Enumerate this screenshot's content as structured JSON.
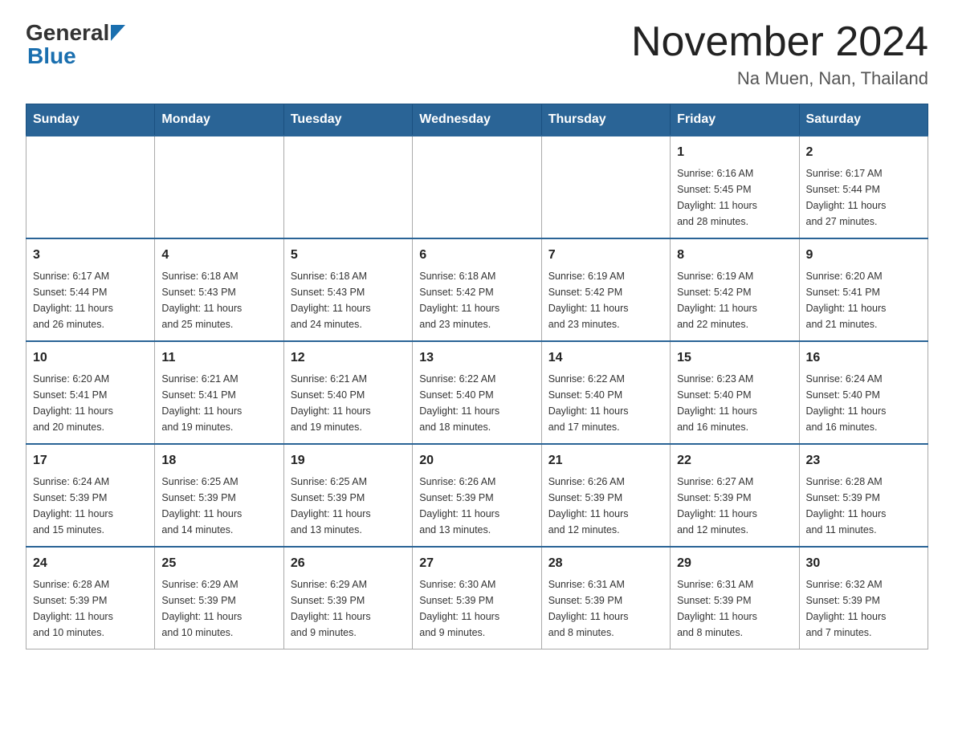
{
  "header": {
    "logo_general": "General",
    "logo_blue": "Blue",
    "month_title": "November 2024",
    "location": "Na Muen, Nan, Thailand"
  },
  "weekdays": [
    "Sunday",
    "Monday",
    "Tuesday",
    "Wednesday",
    "Thursday",
    "Friday",
    "Saturday"
  ],
  "weeks": [
    [
      {
        "day": "",
        "info": ""
      },
      {
        "day": "",
        "info": ""
      },
      {
        "day": "",
        "info": ""
      },
      {
        "day": "",
        "info": ""
      },
      {
        "day": "",
        "info": ""
      },
      {
        "day": "1",
        "info": "Sunrise: 6:16 AM\nSunset: 5:45 PM\nDaylight: 11 hours\nand 28 minutes."
      },
      {
        "day": "2",
        "info": "Sunrise: 6:17 AM\nSunset: 5:44 PM\nDaylight: 11 hours\nand 27 minutes."
      }
    ],
    [
      {
        "day": "3",
        "info": "Sunrise: 6:17 AM\nSunset: 5:44 PM\nDaylight: 11 hours\nand 26 minutes."
      },
      {
        "day": "4",
        "info": "Sunrise: 6:18 AM\nSunset: 5:43 PM\nDaylight: 11 hours\nand 25 minutes."
      },
      {
        "day": "5",
        "info": "Sunrise: 6:18 AM\nSunset: 5:43 PM\nDaylight: 11 hours\nand 24 minutes."
      },
      {
        "day": "6",
        "info": "Sunrise: 6:18 AM\nSunset: 5:42 PM\nDaylight: 11 hours\nand 23 minutes."
      },
      {
        "day": "7",
        "info": "Sunrise: 6:19 AM\nSunset: 5:42 PM\nDaylight: 11 hours\nand 23 minutes."
      },
      {
        "day": "8",
        "info": "Sunrise: 6:19 AM\nSunset: 5:42 PM\nDaylight: 11 hours\nand 22 minutes."
      },
      {
        "day": "9",
        "info": "Sunrise: 6:20 AM\nSunset: 5:41 PM\nDaylight: 11 hours\nand 21 minutes."
      }
    ],
    [
      {
        "day": "10",
        "info": "Sunrise: 6:20 AM\nSunset: 5:41 PM\nDaylight: 11 hours\nand 20 minutes."
      },
      {
        "day": "11",
        "info": "Sunrise: 6:21 AM\nSunset: 5:41 PM\nDaylight: 11 hours\nand 19 minutes."
      },
      {
        "day": "12",
        "info": "Sunrise: 6:21 AM\nSunset: 5:40 PM\nDaylight: 11 hours\nand 19 minutes."
      },
      {
        "day": "13",
        "info": "Sunrise: 6:22 AM\nSunset: 5:40 PM\nDaylight: 11 hours\nand 18 minutes."
      },
      {
        "day": "14",
        "info": "Sunrise: 6:22 AM\nSunset: 5:40 PM\nDaylight: 11 hours\nand 17 minutes."
      },
      {
        "day": "15",
        "info": "Sunrise: 6:23 AM\nSunset: 5:40 PM\nDaylight: 11 hours\nand 16 minutes."
      },
      {
        "day": "16",
        "info": "Sunrise: 6:24 AM\nSunset: 5:40 PM\nDaylight: 11 hours\nand 16 minutes."
      }
    ],
    [
      {
        "day": "17",
        "info": "Sunrise: 6:24 AM\nSunset: 5:39 PM\nDaylight: 11 hours\nand 15 minutes."
      },
      {
        "day": "18",
        "info": "Sunrise: 6:25 AM\nSunset: 5:39 PM\nDaylight: 11 hours\nand 14 minutes."
      },
      {
        "day": "19",
        "info": "Sunrise: 6:25 AM\nSunset: 5:39 PM\nDaylight: 11 hours\nand 13 minutes."
      },
      {
        "day": "20",
        "info": "Sunrise: 6:26 AM\nSunset: 5:39 PM\nDaylight: 11 hours\nand 13 minutes."
      },
      {
        "day": "21",
        "info": "Sunrise: 6:26 AM\nSunset: 5:39 PM\nDaylight: 11 hours\nand 12 minutes."
      },
      {
        "day": "22",
        "info": "Sunrise: 6:27 AM\nSunset: 5:39 PM\nDaylight: 11 hours\nand 12 minutes."
      },
      {
        "day": "23",
        "info": "Sunrise: 6:28 AM\nSunset: 5:39 PM\nDaylight: 11 hours\nand 11 minutes."
      }
    ],
    [
      {
        "day": "24",
        "info": "Sunrise: 6:28 AM\nSunset: 5:39 PM\nDaylight: 11 hours\nand 10 minutes."
      },
      {
        "day": "25",
        "info": "Sunrise: 6:29 AM\nSunset: 5:39 PM\nDaylight: 11 hours\nand 10 minutes."
      },
      {
        "day": "26",
        "info": "Sunrise: 6:29 AM\nSunset: 5:39 PM\nDaylight: 11 hours\nand 9 minutes."
      },
      {
        "day": "27",
        "info": "Sunrise: 6:30 AM\nSunset: 5:39 PM\nDaylight: 11 hours\nand 9 minutes."
      },
      {
        "day": "28",
        "info": "Sunrise: 6:31 AM\nSunset: 5:39 PM\nDaylight: 11 hours\nand 8 minutes."
      },
      {
        "day": "29",
        "info": "Sunrise: 6:31 AM\nSunset: 5:39 PM\nDaylight: 11 hours\nand 8 minutes."
      },
      {
        "day": "30",
        "info": "Sunrise: 6:32 AM\nSunset: 5:39 PM\nDaylight: 11 hours\nand 7 minutes."
      }
    ]
  ]
}
